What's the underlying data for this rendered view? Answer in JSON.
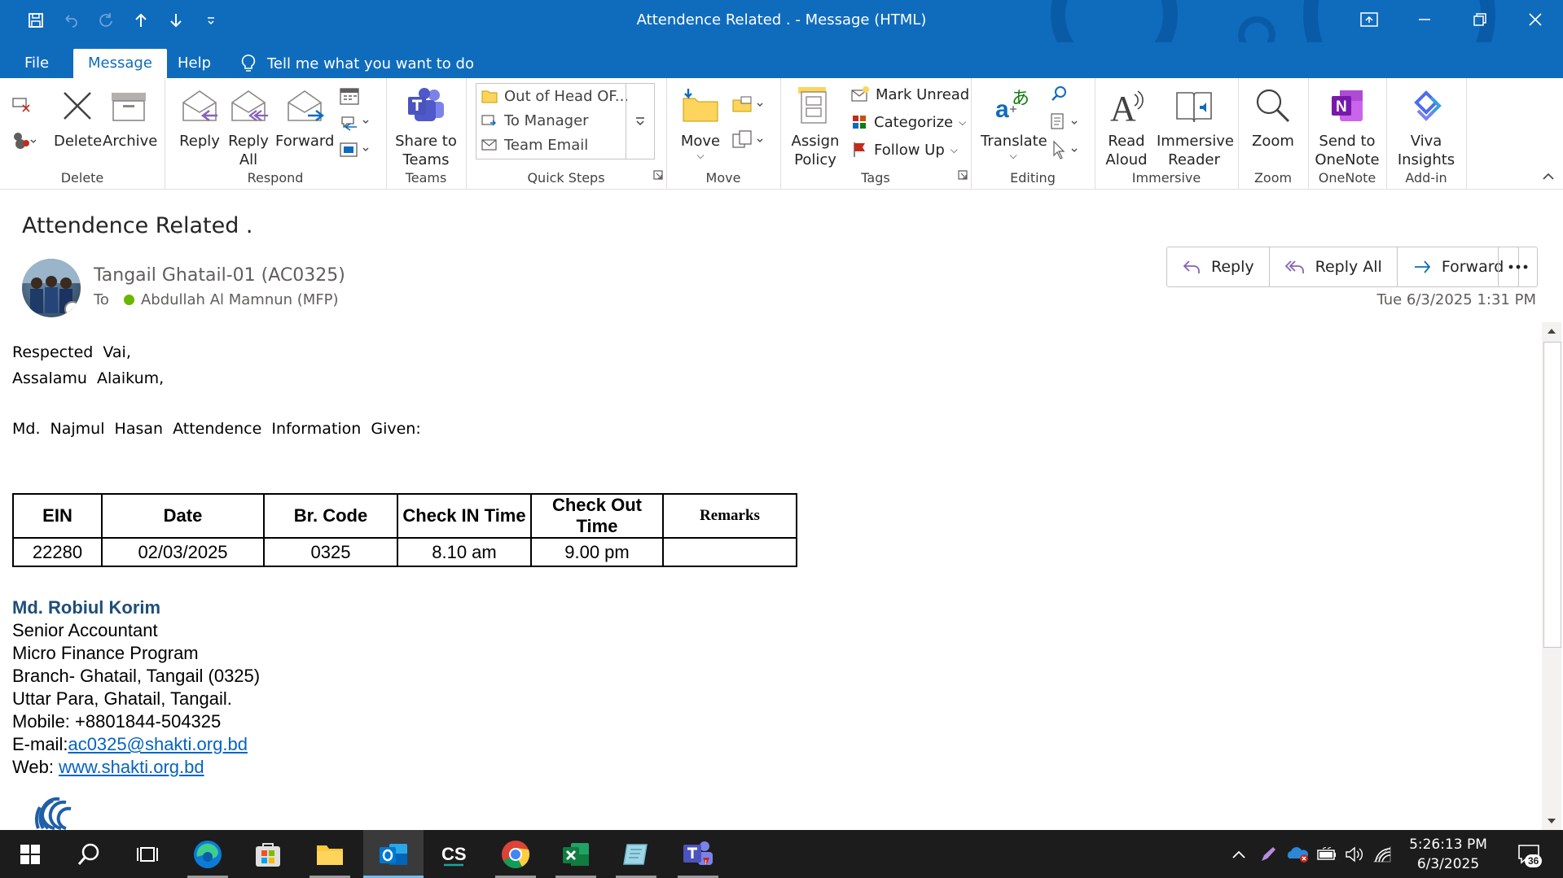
{
  "window": {
    "title": "Attendence Related .  -  Message (HTML)"
  },
  "menu": {
    "file": "File",
    "message": "Message",
    "help": "Help",
    "tell_me": "Tell me what you want to do"
  },
  "ribbon": {
    "delete_group": {
      "label": "Delete",
      "delete": "Delete",
      "archive": "Archive"
    },
    "respond_group": {
      "label": "Respond",
      "reply": "Reply",
      "reply_all_1": "Reply",
      "reply_all_2": "All",
      "forward": "Forward"
    },
    "teams_group": {
      "label": "Teams",
      "share_1": "Share to",
      "share_2": "Teams"
    },
    "quick_steps_group": {
      "label": "Quick Steps",
      "items": [
        "Out of Head OF...",
        "To Manager",
        "Team Email"
      ]
    },
    "move_group": {
      "label": "Move",
      "move": "Move"
    },
    "tags_group": {
      "label": "Tags",
      "assign_1": "Assign",
      "assign_2": "Policy",
      "mark_unread": "Mark Unread",
      "categorize": "Categorize",
      "follow_up": "Follow Up"
    },
    "editing_group": {
      "label": "Editing",
      "translate": "Translate"
    },
    "immersive_group": {
      "label": "Immersive",
      "read_1": "Read",
      "read_2": "Aloud",
      "reader_1": "Immersive",
      "reader_2": "Reader"
    },
    "zoom_group": {
      "label": "Zoom",
      "zoom": "Zoom"
    },
    "onenote_group": {
      "label": "OneNote",
      "send_1": "Send to",
      "send_2": "OneNote"
    },
    "addin_group": {
      "label": "Add-in",
      "viva_1": "Viva",
      "viva_2": "Insights"
    }
  },
  "message": {
    "subject": "Attendence Related .",
    "sender": "Tangail Ghatail-01 (AC0325)",
    "to_label": "To",
    "recipient": "Abdullah Al Mamnun (MFP)",
    "timestamp": "Tue 6/3/2025 1:31 PM",
    "actions": {
      "reply": "Reply",
      "reply_all": "Reply All",
      "forward": "Forward"
    }
  },
  "body": {
    "greeting": "Respected Vai,",
    "salam": "Assalamu Alaikum,",
    "intro": "Md. Najmul Hasan Attendence Information Given:",
    "table": {
      "headers": [
        "EIN",
        "Date",
        "Br. Code",
        "Check IN Time",
        "Check Out Time",
        "Remarks"
      ],
      "rows": [
        [
          "22280",
          "02/03/2025",
          "0325",
          "8.10 am",
          "9.00 pm",
          ""
        ]
      ]
    },
    "signature": {
      "name": "Md. Robiul Korim",
      "title": "Senior Accountant",
      "program": "Micro Finance Program",
      "branch": "Branch- Ghatail, Tangail (0325)",
      "address": "Uttar Para, Ghatail, Tangail.",
      "mobile": "Mobile: +8801844-504325",
      "email_label": "E-mail:",
      "email": "ac0325@shakti.org.bd",
      "web_label": "Web: ",
      "web": "www.shakti.org.bd"
    }
  },
  "taskbar": {
    "apps": [
      "start-icon",
      "search-icon",
      "task-view-icon",
      "edge-icon",
      "store-icon",
      "file-explorer-icon",
      "outlook-icon",
      "cs-icon",
      "chrome-icon",
      "excel-icon",
      "app-icon",
      "teams-icon"
    ],
    "cs_label": "CS",
    "time": "5:26:13 PM",
    "date": "6/3/2025",
    "notifications": "36"
  },
  "colors": {
    "accent": "#0f6cbd",
    "signature_name": "#1f4e79",
    "link": "#0563c1",
    "taskbar": "#1c1c1c"
  }
}
